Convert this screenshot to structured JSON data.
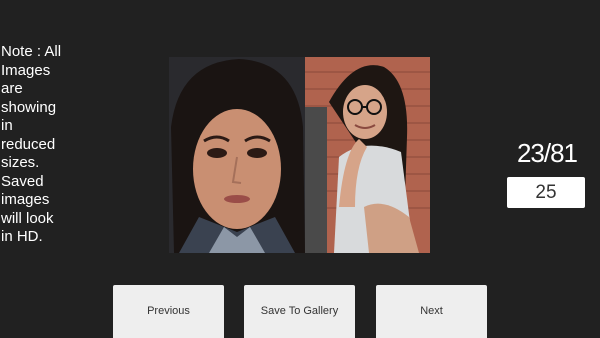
{
  "note": {
    "text": "Note : All Images are showing in reduced sizes. Saved images will look in HD."
  },
  "viewer": {
    "counter": "23/81",
    "jump_value": "25"
  },
  "buttons": {
    "previous_label": "Previous",
    "save_label": "Save To Gallery",
    "next_label": "Next"
  },
  "colors": {
    "background": "#212121",
    "button_bg": "#eeeeee",
    "button_text": "#333333",
    "text": "#ffffff"
  }
}
